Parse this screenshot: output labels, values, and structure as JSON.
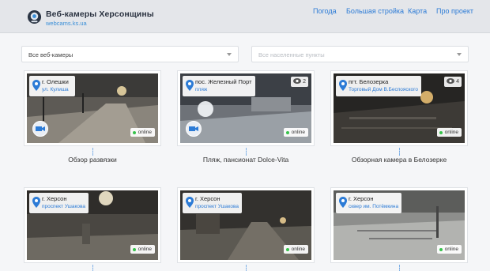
{
  "header": {
    "title": "Веб-камеры Херсонщины",
    "subtitle": "webcams.ks.ua",
    "nav": [
      "Погода",
      "Большая стройка",
      "Карта",
      "Про проект"
    ]
  },
  "filters": {
    "camera_select": "Все веб-камеры",
    "places_select": "Все населенные пункты"
  },
  "cards": [
    {
      "city": "г. Олешки",
      "street": "ул. Кулиша",
      "status": "online",
      "caption": "Обзор развязки"
    },
    {
      "city": "пос. Железный Порт",
      "street": "пляж",
      "views": "2",
      "status": "online",
      "caption": "Пляж, пансионат Dolce-Vita"
    },
    {
      "city": "пгт. Белозерка",
      "street": "Торговый Дом В.Беспояского",
      "views": "4",
      "status": "online",
      "caption": "Обзорная камера в Белозерке"
    },
    {
      "city": "г. Херсон",
      "street": "проспект Ушакова",
      "status": "online"
    },
    {
      "city": "г. Херсон",
      "street": "проспект Ушакова",
      "status": "online"
    },
    {
      "city": "г. Херсон",
      "street": "сквер им. Потёмкина",
      "status": "online"
    }
  ],
  "colors": {
    "accent": "#2c7bd6",
    "online": "#37c24b"
  }
}
